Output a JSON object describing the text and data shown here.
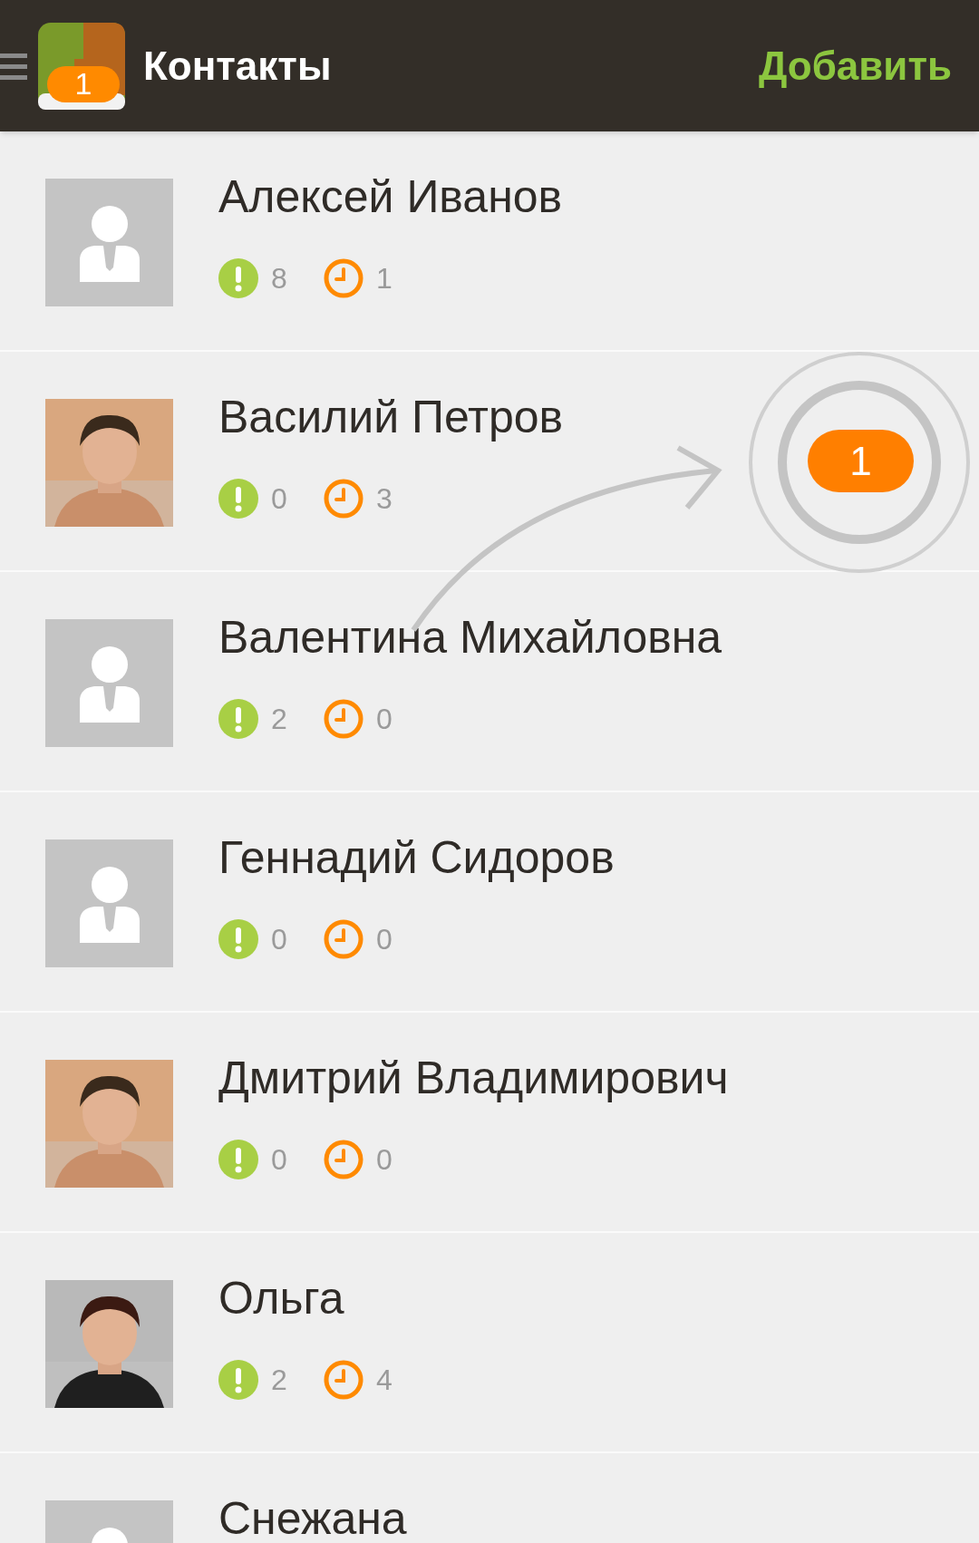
{
  "header": {
    "badge": "1",
    "title": "Контакты",
    "action": "Добавить"
  },
  "contacts": [
    {
      "name": "Алексей Иванов",
      "avatar": {
        "kind": "placeholder"
      },
      "alerts": "8",
      "timers": "1"
    },
    {
      "name": "Василий Петров",
      "alerts": "0",
      "timers": "3"
    },
    {
      "name": "Валентина Михайловна",
      "avatar": {
        "kind": "placeholder"
      },
      "alerts": "2",
      "timers": "0"
    },
    {
      "name": "Геннадий Сидоров",
      "avatar": {
        "kind": "placeholder"
      },
      "alerts": "0",
      "timers": "0"
    },
    {
      "name": "Дмитрий Владимирович",
      "alerts": "0",
      "timers": "0"
    },
    {
      "name": "Ольга",
      "alerts": "2",
      "timers": "4"
    },
    {
      "name": "Снежана",
      "avatar": {
        "kind": "placeholder"
      }
    }
  ],
  "tutorial": {
    "badge": "1"
  }
}
